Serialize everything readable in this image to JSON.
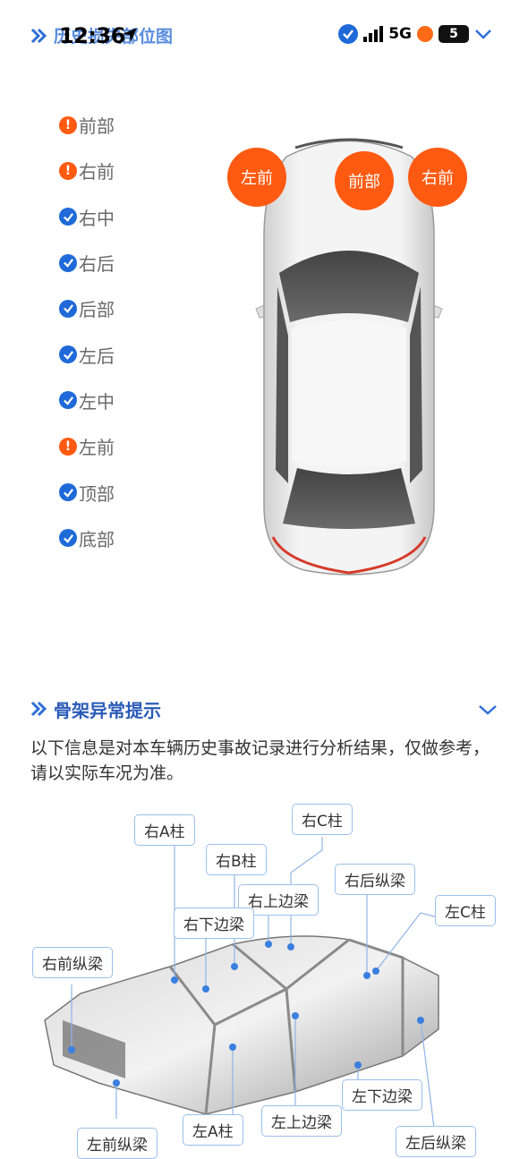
{
  "status_bar": {
    "time": "12:36",
    "network": "5G",
    "battery": "5"
  },
  "section1": {
    "title": "历史损失部位图"
  },
  "parts": [
    {
      "label": "前部",
      "state": "warn"
    },
    {
      "label": "右前",
      "state": "warn"
    },
    {
      "label": "右中",
      "state": "ok"
    },
    {
      "label": "右后",
      "state": "ok"
    },
    {
      "label": "后部",
      "state": "ok"
    },
    {
      "label": "左后",
      "state": "ok"
    },
    {
      "label": "左中",
      "state": "ok"
    },
    {
      "label": "左前",
      "state": "warn"
    },
    {
      "label": "顶部",
      "state": "ok"
    },
    {
      "label": "底部",
      "state": "ok"
    }
  ],
  "car_markers": {
    "left_front": "左前",
    "front": "前部",
    "right_front": "右前"
  },
  "section2": {
    "title": "骨架异常提示",
    "notice": "以下信息是对本车辆历史事故记录进行分析结果，仅做参考，请以实际车况为准。"
  },
  "frame_labels": {
    "right_a_pillar": "右A柱",
    "right_c_pillar": "右C柱",
    "right_b_pillar": "右B柱",
    "right_rear_rail": "右后纵梁",
    "right_upper_rail": "右上边梁",
    "left_c_pillar": "左C柱",
    "right_lower_rail": "右下边梁",
    "right_front_rail": "右前纵梁",
    "left_lower_rail": "左下边梁",
    "left_upper_rail": "左上边梁",
    "left_a_pillar": "左A柱",
    "left_front_rail": "左前纵梁",
    "left_rear_rail": "左后纵梁"
  },
  "colors": {
    "accent_blue": "#1f6ad8",
    "warning_orange": "#ff5a12"
  }
}
